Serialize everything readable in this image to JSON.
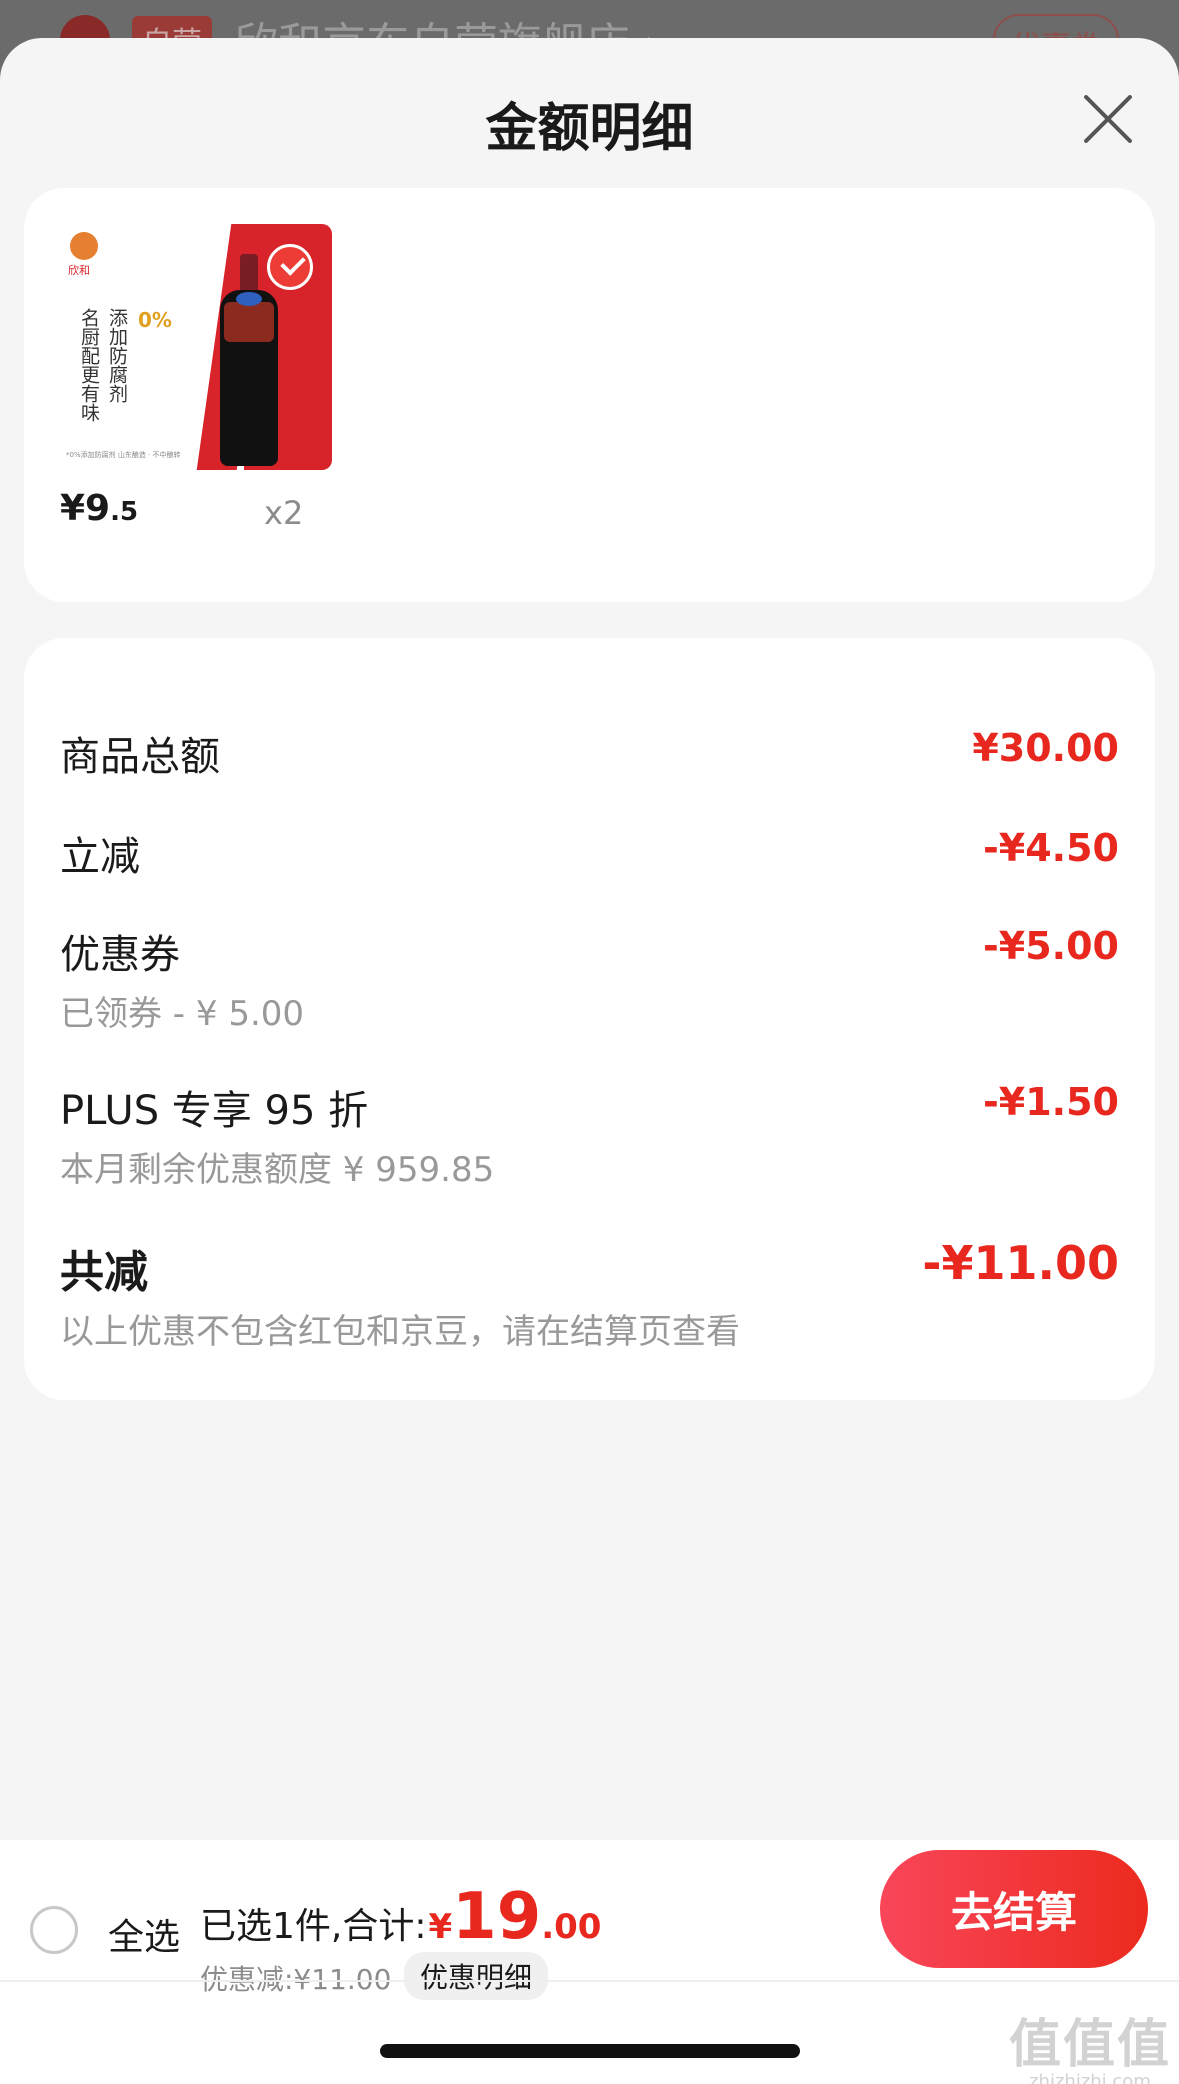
{
  "background": {
    "tag": "自营",
    "store_name": "欣和京东自营旗舰店 ›",
    "coupon": "优惠券"
  },
  "sheet": {
    "title": "金额明细"
  },
  "product": {
    "brand_logo_text": "欣和",
    "image_text_col1": "名厨配更有味",
    "image_text_col2": "添加防腐剂",
    "image_text_zero": "0%",
    "image_small_text": "*0%添加防腐剂  山东酿造 · 不中酿转",
    "price_int": "¥9",
    "price_dec": ".5",
    "quantity": "x2"
  },
  "detail": {
    "goods_total_label": "商品总额",
    "goods_total_value": "¥30.00",
    "instant_discount_label": "立减",
    "instant_discount_value": "-¥4.50",
    "coupon_label": "优惠券",
    "coupon_sub": "已领券 - ¥ 5.00",
    "coupon_value": "-¥5.00",
    "plus_label": "PLUS 专享 95 折",
    "plus_sub": "本月剩余优惠额度 ¥ 959.85",
    "plus_value": "-¥1.50",
    "total_reduction_label": "共减",
    "total_reduction_value": "-¥11.00",
    "note": "以上优惠不包含红包和京豆，请在结算页查看"
  },
  "bottom_bar": {
    "select_all": "全选",
    "selected_summary": "已选1件,合计:",
    "currency": "¥",
    "total_int": "19",
    "total_dec": ".00",
    "discount_text": "优惠减:¥11.00",
    "detail_chip": "优惠明细",
    "checkout_label": "去结算"
  },
  "watermark": {
    "big": "值值值",
    "small": "zhizhizhi.com"
  },
  "colors": {
    "accent_red": "#e8281e",
    "checkout_gradient_start": "#f9465a",
    "checkout_gradient_end": "#ec2a1e"
  }
}
